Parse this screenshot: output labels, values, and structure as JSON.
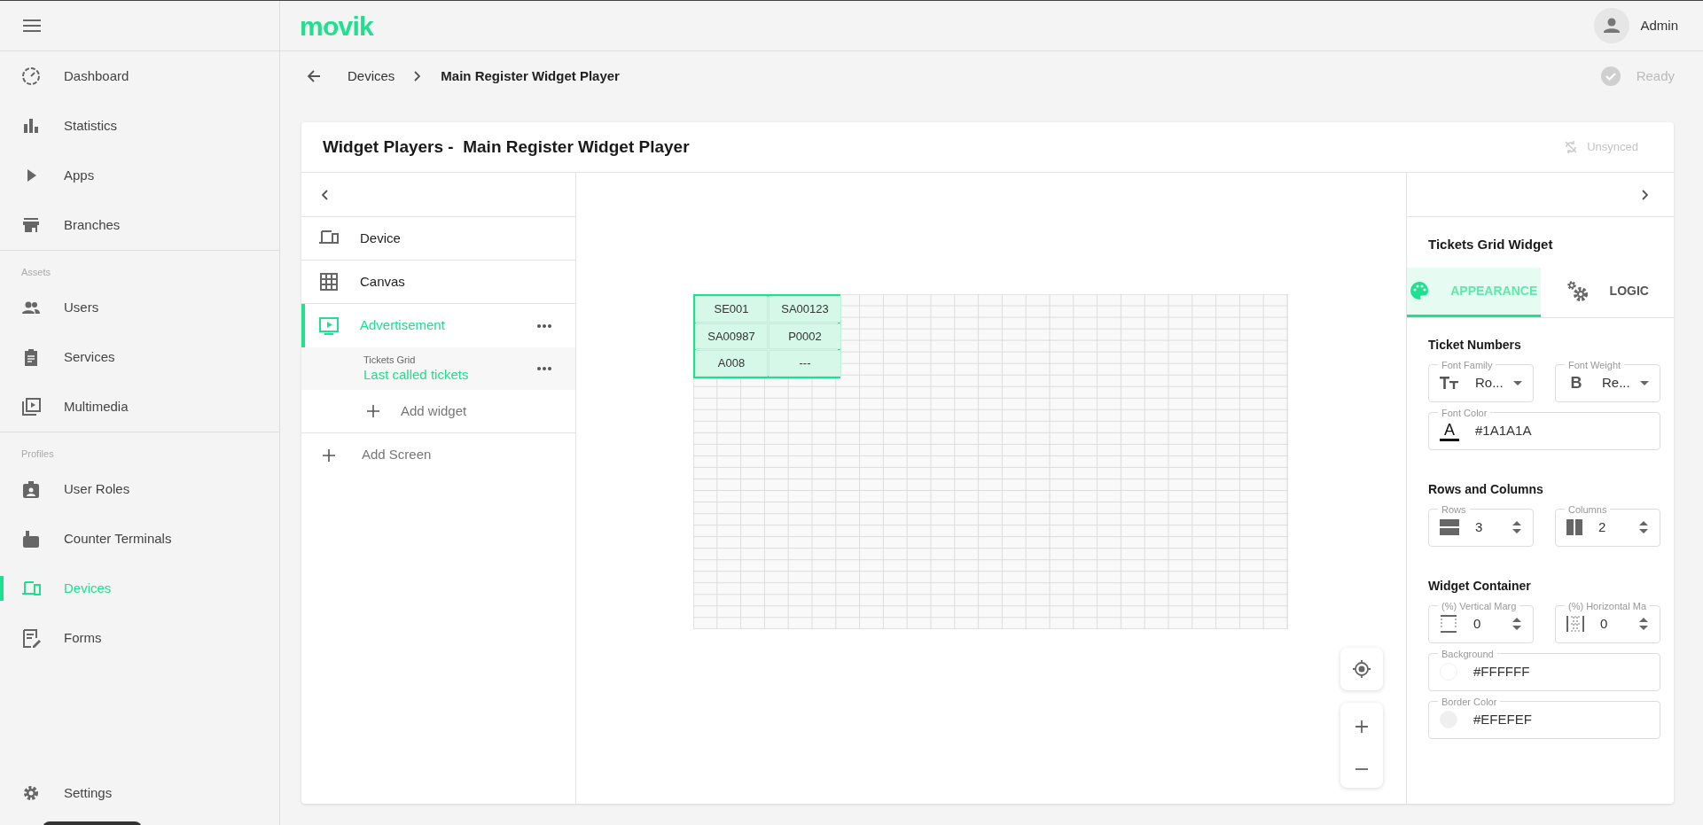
{
  "app": {
    "logo": "movik",
    "user": "Admin"
  },
  "sidebar": {
    "sections": [
      {
        "items": [
          {
            "label": "Dashboard",
            "selected": false
          },
          {
            "label": "Statistics",
            "selected": false
          },
          {
            "label": "Apps",
            "selected": false
          },
          {
            "label": "Branches",
            "selected": false
          }
        ]
      },
      {
        "heading": "Assets",
        "items": [
          {
            "label": "Users",
            "selected": false
          },
          {
            "label": "Services",
            "selected": false
          },
          {
            "label": "Multimedia",
            "selected": false
          }
        ]
      },
      {
        "heading": "Profiles",
        "items": [
          {
            "label": "User Roles",
            "selected": false
          },
          {
            "label": "Counter Terminals",
            "selected": false
          },
          {
            "label": "Devices",
            "selected": true
          },
          {
            "label": "Forms",
            "selected": false
          }
        ]
      }
    ],
    "footer": {
      "label": "Settings",
      "selected": false
    }
  },
  "breadcrumbs": [
    "Devices",
    "Main Register Widget Player"
  ],
  "status": "Ready",
  "card": {
    "title": "Widget Players -  Main Register Widget Player",
    "sync_status": "Unsynced"
  },
  "tree": {
    "items": [
      {
        "kind": "device",
        "label": "Device",
        "selected": false
      },
      {
        "kind": "canvas",
        "label": "Canvas",
        "selected": false
      },
      {
        "kind": "screen",
        "label": "Advertisement",
        "selected": true,
        "widgets": [
          {
            "type": "Tickets Grid",
            "name": "Last called tickets",
            "selected": true
          }
        ],
        "add_widget": "Add widget"
      }
    ],
    "add_screen": "Add Screen"
  },
  "canvas_widget": {
    "cells": [
      "SE001",
      "SA00123",
      "SA00987",
      "P0002",
      "A008",
      "---"
    ]
  },
  "properties": {
    "title": "Tickets Grid Widget",
    "tabs": [
      {
        "label": "APPEARANCE",
        "selected": true
      },
      {
        "label": "LOGIC",
        "selected": false
      }
    ],
    "sections": [
      {
        "heading": "Ticket Numbers",
        "fields": [
          {
            "kind": "select",
            "label": "Font Family",
            "value": "Ro..."
          },
          {
            "kind": "select",
            "icon_text": "B",
            "label": "Font Weight",
            "value": "Re..."
          },
          {
            "kind": "text",
            "icon_text": "A",
            "label": "Font Color",
            "value": "#1A1A1A"
          }
        ]
      },
      {
        "heading": "Rows and Columns",
        "fields": [
          {
            "kind": "number",
            "label": "Rows",
            "value": "3"
          },
          {
            "kind": "number",
            "label": "Columns",
            "value": "2"
          }
        ]
      },
      {
        "heading": "Widget Container",
        "fields": [
          {
            "kind": "number",
            "label": "(%) Vertical Marg",
            "value": "0"
          },
          {
            "kind": "number",
            "label": "(%) Horizontal Ma",
            "value": "0"
          },
          {
            "kind": "color",
            "color": "#ffffff",
            "label": "Background",
            "value": "#FFFFFF"
          },
          {
            "kind": "color",
            "color": "#efefef",
            "label": "Border Color",
            "value": "#EFEFEF"
          }
        ]
      }
    ]
  }
}
